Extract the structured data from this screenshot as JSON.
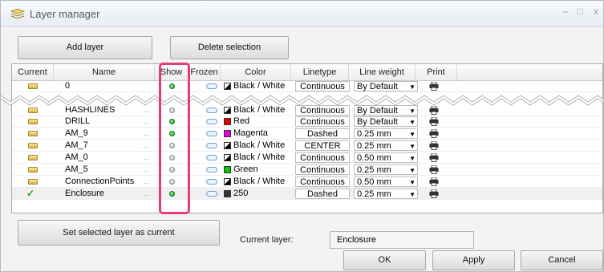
{
  "window": {
    "title": "Layer manager",
    "minimize": "–",
    "maximize": "□",
    "close": "x"
  },
  "toolbar": {
    "add_layer": "Add layer",
    "delete_selection": "Delete selection"
  },
  "grid": {
    "headers": [
      "Current",
      "Name",
      "Show",
      "Frozen",
      "Color",
      "Linetype",
      "Line weight",
      "Print"
    ],
    "rows": [
      {
        "current": "folder",
        "name": "0",
        "dots": "",
        "show": "on",
        "color": "Black / White",
        "swatch": "bw",
        "linetype": "Continuous",
        "lineweight": "By Default",
        "print": true,
        "selected": false
      },
      {
        "current": "folder",
        "name": "HASHLINES",
        "dots": "...",
        "show": "off",
        "color": "Black / White",
        "swatch": "bw",
        "linetype": "Continuous",
        "lineweight": "By Default",
        "print": true,
        "selected": false
      },
      {
        "current": "folder",
        "name": "DRILL",
        "dots": "...",
        "show": "on",
        "color": "Red",
        "swatch": "#e00000",
        "linetype": "Continuous",
        "lineweight": "By Default",
        "print": true,
        "selected": false
      },
      {
        "current": "folder",
        "name": "AM_9",
        "dots": "...",
        "show": "on",
        "color": "Magenta",
        "swatch": "#e000e0",
        "linetype": "Dashed",
        "lineweight": "0.25 mm",
        "print": true,
        "selected": false
      },
      {
        "current": "folder",
        "name": "AM_7",
        "dots": "...",
        "show": "off",
        "color": "Black / White",
        "swatch": "bw",
        "linetype": "CENTER",
        "lineweight": "0.25 mm",
        "print": true,
        "selected": false
      },
      {
        "current": "folder",
        "name": "AM_0",
        "dots": "...",
        "show": "off",
        "color": "Black / White",
        "swatch": "bw",
        "linetype": "Continuous",
        "lineweight": "0.50 mm",
        "print": true,
        "selected": false
      },
      {
        "current": "folder",
        "name": "AM_5",
        "dots": "...",
        "show": "off",
        "color": "Green",
        "swatch": "#00cc00",
        "linetype": "Continuous",
        "lineweight": "0.25 mm",
        "print": true,
        "selected": false
      },
      {
        "current": "folder",
        "name": "ConnectionPoints",
        "dots": "...",
        "show": "off",
        "color": "Black / White",
        "swatch": "bw",
        "linetype": "Continuous",
        "lineweight": "0.50 mm",
        "print": true,
        "selected": false
      },
      {
        "current": "check",
        "name": "Enclosure",
        "dots": "...",
        "show": "on",
        "color": "250",
        "swatch": "#333333",
        "linetype": "Dashed",
        "lineweight": "0.25 mm",
        "print": true,
        "selected": true
      }
    ]
  },
  "footer": {
    "set_current": "Set selected layer as current",
    "current_layer_label": "Current layer:",
    "current_layer_value": "Enclosure",
    "ok": "OK",
    "apply": "Apply",
    "cancel": "Cancel"
  },
  "colors": {
    "highlight": "#e73c7b",
    "show_on": "#18a818",
    "show_off": "#b5b5b5"
  },
  "icons": {
    "title": "layer-stack-icon",
    "current": "folder-icon",
    "frozen": "snowflake-toggle-icon",
    "print": "printer-icon",
    "current_check": "checkmark-icon"
  }
}
